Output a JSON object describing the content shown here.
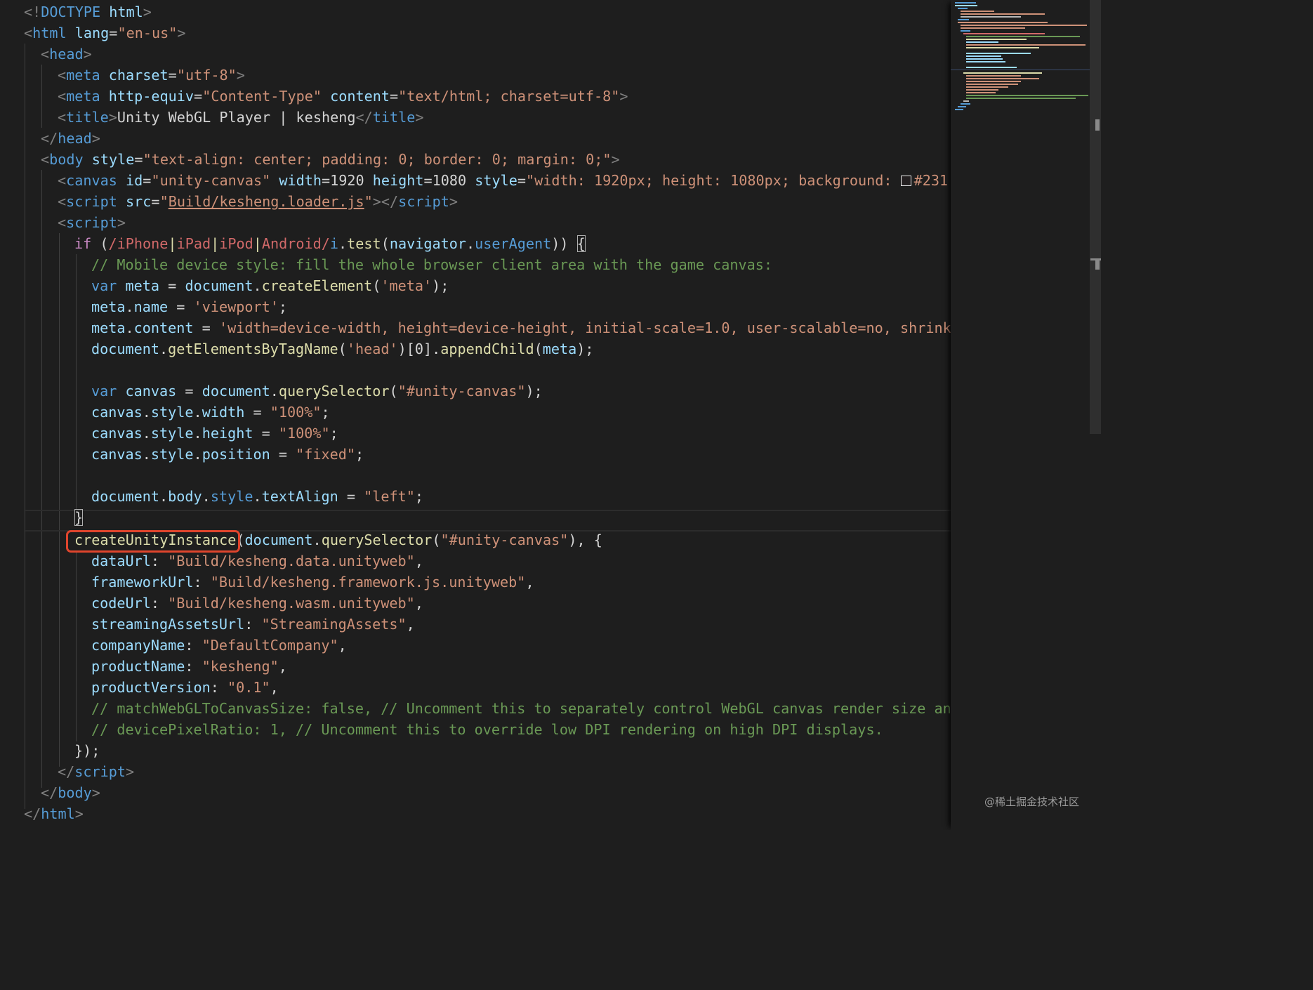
{
  "editor": {
    "theme": "dark",
    "language": "html",
    "colors": {
      "background": "#1e1e1e",
      "tag": "#569cd6",
      "attribute": "#9cdcfe",
      "string": "#ce9178",
      "comment": "#6a9955",
      "function": "#dcdcaa",
      "keyword_control": "#c586c0",
      "regex": "#d16969",
      "annotation_highlight": "#e0452d"
    },
    "highlighted_token": "createUnityInstance",
    "color_swatch_value": "#231"
  },
  "code": {
    "l1": {
      "a": "<!",
      "b": "DOCTYPE",
      "c": " html",
      "d": ">"
    },
    "l2": {
      "a": "<",
      "b": "html",
      "c": " lang",
      "d": "=",
      "e": "\"en-us\"",
      "f": ">"
    },
    "l3": {
      "a": "<",
      "b": "head",
      "c": ">"
    },
    "l4": {
      "a": "<",
      "b": "meta",
      "c": " charset",
      "d": "=",
      "e": "\"utf-8\"",
      "f": ">"
    },
    "l5": {
      "a": "<",
      "b": "meta",
      "c": " http-equiv",
      "d": "=",
      "e": "\"Content-Type\"",
      "f": " content",
      "g": "=",
      "h": "\"text/html; charset=utf-8\"",
      "i": ">"
    },
    "l6": {
      "a": "<",
      "b": "title",
      "c": ">",
      "d": "Unity WebGL Player | kesheng",
      "e": "</",
      "f": "title",
      "g": ">"
    },
    "l7": {
      "a": "</",
      "b": "head",
      "c": ">"
    },
    "l8": {
      "a": "<",
      "b": "body",
      "c": " style",
      "d": "=",
      "e": "\"text-align: center; padding: 0; border: 0; margin: 0;\"",
      "f": ">"
    },
    "l9": {
      "a": "<",
      "b": "canvas",
      "c": " id",
      "d": "=",
      "e": "\"unity-canvas\"",
      "f": " width",
      "g": "=1920",
      "h": " height",
      "i": "=1080",
      "j": " style",
      "k": "=",
      "l": "\"width: 1920px; height: 1080px; background: ",
      "m": "#231"
    },
    "l10": {
      "a": "<",
      "b": "script",
      "c": " src",
      "d": "=",
      "e": "\"",
      "f": "Build/kesheng.loader.js",
      "g": "\"",
      "h": "></",
      "i": "script",
      "j": ">"
    },
    "l11": {
      "a": "<",
      "b": "script",
      "c": ">"
    },
    "l12": {
      "a": "if",
      "b": " (",
      "c": "/iPhone",
      "d": "|",
      "e": "iPad",
      "f": "|",
      "g": "iPod",
      "h": "|",
      "i": "Android/",
      "j": "i",
      "k": ".",
      "l": "test",
      "m": "(",
      "n": "navigator",
      "o": ".",
      "p": "userAgent",
      "q": ")) ",
      "r": "{"
    },
    "l13": {
      "a": "// Mobile device style: fill the whole browser client area with the game canvas:"
    },
    "l14": {
      "a": "var",
      "b": " ",
      "c": "meta",
      "d": " = ",
      "e": "document",
      "f": ".",
      "g": "createElement",
      "h": "(",
      "i": "'meta'",
      "j": ");"
    },
    "l15": {
      "a": "meta",
      "b": ".",
      "c": "name",
      "d": " = ",
      "e": "'viewport'",
      "f": ";"
    },
    "l16": {
      "a": "meta",
      "b": ".",
      "c": "content",
      "d": " = ",
      "e": "'width=device-width, height=device-height, initial-scale=1.0, user-scalable=no, shrink"
    },
    "l17": {
      "a": "document",
      "b": ".",
      "c": "getElementsByTagName",
      "d": "(",
      "e": "'head'",
      "f": ")[",
      "g": "0",
      "h": "].",
      "i": "appendChild",
      "j": "(",
      "k": "meta",
      "l": ");"
    },
    "l19": {
      "a": "var",
      "b": " ",
      "c": "canvas",
      "d": " = ",
      "e": "document",
      "f": ".",
      "g": "querySelector",
      "h": "(",
      "i": "\"#unity-canvas\"",
      "j": ");"
    },
    "l20": {
      "a": "canvas",
      "b": ".",
      "c": "style",
      "d": ".",
      "e": "width",
      "f": " = ",
      "g": "\"100%\"",
      "h": ";"
    },
    "l21": {
      "a": "canvas",
      "b": ".",
      "c": "style",
      "d": ".",
      "e": "height",
      "f": " = ",
      "g": "\"100%\"",
      "h": ";"
    },
    "l22": {
      "a": "canvas",
      "b": ".",
      "c": "style",
      "d": ".",
      "e": "position",
      "f": " = ",
      "g": "\"fixed\"",
      "h": ";"
    },
    "l24": {
      "a": "document",
      "b": ".",
      "c": "body",
      "d": ".",
      "e": "style",
      "f": ".",
      "g": "textAlign",
      "h": " = ",
      "i": "\"left\"",
      "j": ";"
    },
    "l25": {
      "a": "}"
    },
    "l26": {
      "a": "createUnityInstance",
      "b": "(",
      "c": "document",
      "d": ".",
      "e": "querySelector",
      "f": "(",
      "g": "\"#unity-canvas\"",
      "h": "), {"
    },
    "l27": {
      "a": "dataUrl",
      "b": ": ",
      "c": "\"Build/kesheng.data.unityweb\"",
      "d": ","
    },
    "l28": {
      "a": "frameworkUrl",
      "b": ": ",
      "c": "\"Build/kesheng.framework.js.unityweb\"",
      "d": ","
    },
    "l29": {
      "a": "codeUrl",
      "b": ": ",
      "c": "\"Build/kesheng.wasm.unityweb\"",
      "d": ","
    },
    "l30": {
      "a": "streamingAssetsUrl",
      "b": ": ",
      "c": "\"StreamingAssets\"",
      "d": ","
    },
    "l31": {
      "a": "companyName",
      "b": ": ",
      "c": "\"DefaultCompany\"",
      "d": ","
    },
    "l32": {
      "a": "productName",
      "b": ": ",
      "c": "\"kesheng\"",
      "d": ","
    },
    "l33": {
      "a": "productVersion",
      "b": ": ",
      "c": "\"0.1\"",
      "d": ","
    },
    "l34": {
      "a": "// matchWebGLToCanvasSize: false, // Uncomment this to separately control WebGL canvas render size an"
    },
    "l35": {
      "a": "// devicePixelRatio: 1, // Uncomment this to override low DPI rendering on high DPI displays."
    },
    "l36": {
      "a": "});"
    },
    "l37": {
      "a": "</",
      "b": "script",
      "c": ">"
    },
    "l38": {
      "a": "</",
      "b": "body",
      "c": ">"
    },
    "l39": {
      "a": "</",
      "b": "html",
      "c": ">"
    }
  },
  "watermark": "@稀土掘金技术社区"
}
